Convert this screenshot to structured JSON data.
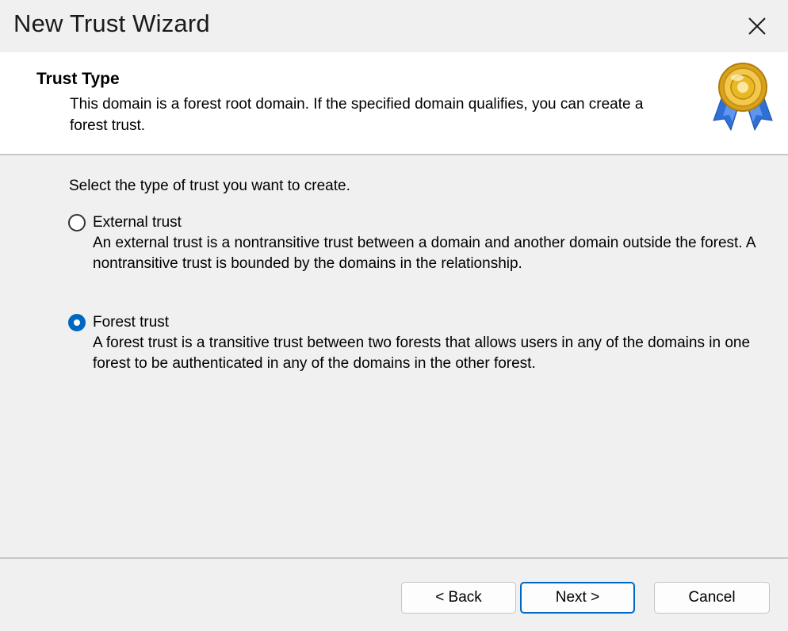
{
  "window": {
    "title": "New Trust Wizard"
  },
  "header": {
    "title": "Trust Type",
    "description": "This domain is a forest root domain. If the specified domain qualifies, you can create a forest trust.",
    "badge_icon": "certificate-ribbon-icon"
  },
  "content": {
    "prompt": "Select the type of trust you want to create.",
    "options": [
      {
        "label": "External trust",
        "description": "An external trust is a nontransitive trust between a domain and another domain outside the forest. A nontransitive trust is bounded by the domains in the relationship.",
        "selected": false
      },
      {
        "label": "Forest trust",
        "description": "A forest trust is a transitive trust between two forests that allows users in any of the domains in one forest to be authenticated in any of the domains in the other forest.",
        "selected": true
      }
    ]
  },
  "buttons": {
    "back": "< Back",
    "next": "Next >",
    "cancel": "Cancel"
  },
  "colors": {
    "accent": "#0067c0",
    "header_bg": "#ffffff",
    "body_bg": "#f0f0f0",
    "badge_gold": "#e8b923",
    "badge_blue": "#2f6fd6"
  }
}
